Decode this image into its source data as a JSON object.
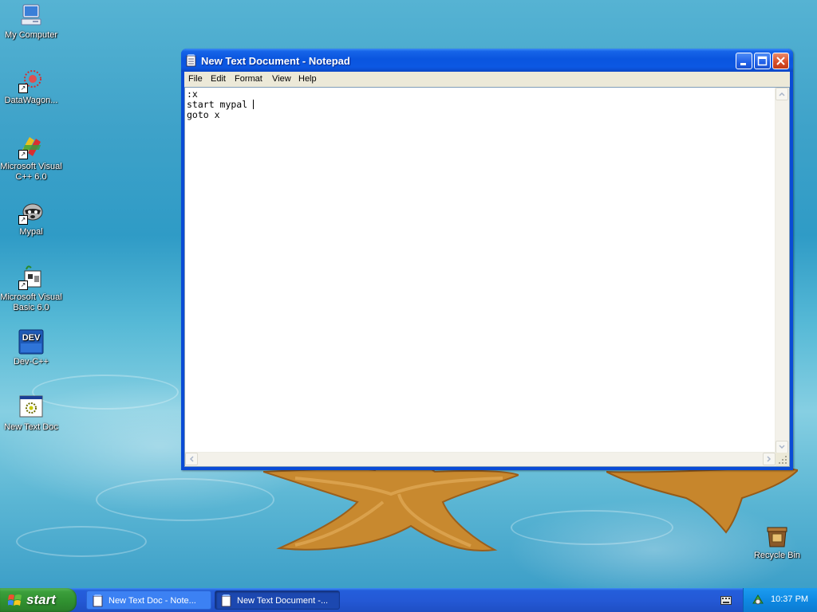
{
  "desktop": {
    "icons": [
      {
        "label": "My Computer"
      },
      {
        "label": "DataWagon..."
      },
      {
        "label": "Microsoft Visual C++ 6.0"
      },
      {
        "label": "Mypal"
      },
      {
        "label": "Microsoft Visual Basic 6.0"
      },
      {
        "label": "Dev-C++"
      },
      {
        "label": "New Text Doc"
      },
      {
        "label": "Recycle Bin"
      }
    ],
    "devcpp_badge": "DEV"
  },
  "notepad": {
    "title": "New Text Document - Notepad",
    "menu": [
      "File",
      "Edit",
      "Format",
      "View",
      "Help"
    ],
    "lines": [
      ":x",
      "start mypal ",
      "goto x"
    ]
  },
  "taskbar": {
    "start_label": "start",
    "items": [
      {
        "label": "New Text Doc - Note..."
      },
      {
        "label": "New Text Document -..."
      }
    ],
    "clock": "10:37 PM"
  }
}
